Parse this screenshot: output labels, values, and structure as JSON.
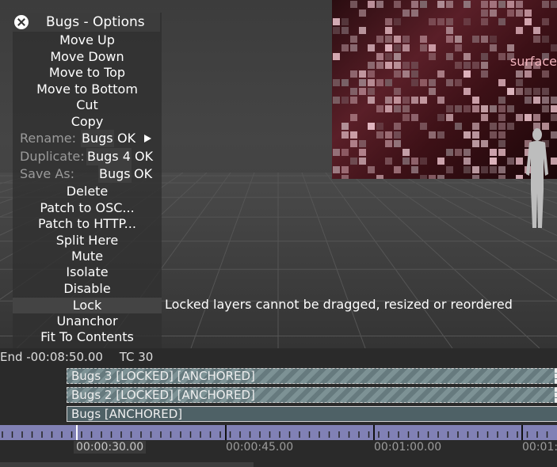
{
  "surface": {
    "label": "surface"
  },
  "menu": {
    "title": "Bugs - Options",
    "items": [
      "Move Up",
      "Move Down",
      "Move to Top",
      "Move to Bottom",
      "Cut",
      "Copy"
    ],
    "rename": {
      "label": "Rename:",
      "value": "Bugs",
      "ok": "OK"
    },
    "duplicate": {
      "label": "Duplicate:",
      "value": "Bugs 4",
      "ok": "OK"
    },
    "save_as": {
      "label": "Save As:",
      "value": "Bugs",
      "ok": "OK"
    },
    "items2": [
      "Delete",
      "Patch to OSC...",
      "Patch to HTTP...",
      "Split Here",
      "Mute",
      "Isolate",
      "Disable",
      "Lock",
      "Unanchor",
      "Fit To Contents"
    ],
    "selected": "Lock"
  },
  "tooltip": "Locked layers cannot be dragged, resized or reordered",
  "status": {
    "end": "End -00:08:50.00",
    "tc": "TC 30"
  },
  "tracks": [
    {
      "label": "Bugs 3 [LOCKED] [ANCHORED]",
      "locked": true
    },
    {
      "label": "Bugs 2 [LOCKED] [ANCHORED]",
      "locked": true
    },
    {
      "label": "Bugs [ANCHORED]",
      "locked": false
    }
  ],
  "timeline": {
    "current": "00:00:30.00",
    "labels": [
      "00:00:45.00",
      "00:01:00.00",
      "00:01:"
    ]
  }
}
